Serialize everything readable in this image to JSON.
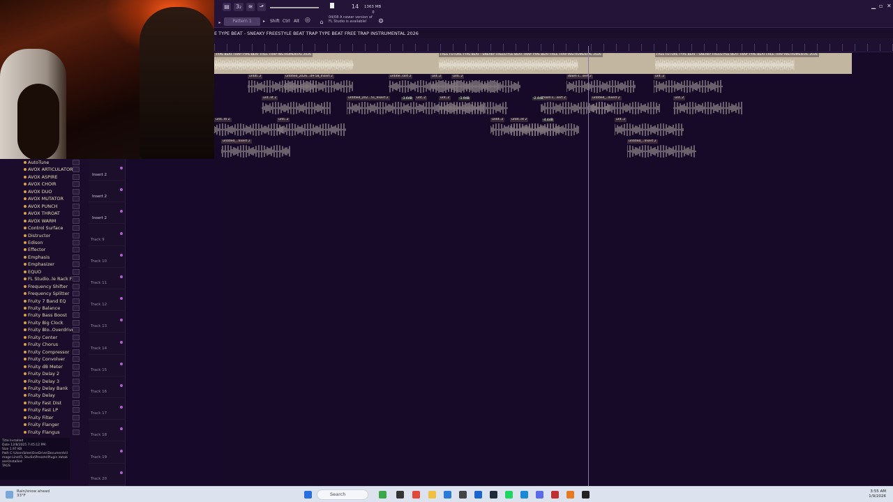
{
  "app": {
    "title": "FL Studio"
  },
  "toolbar": {
    "pattern_label": "Pattern 1",
    "modifier_keys": [
      "Shift",
      "Ctrl",
      "Alt"
    ],
    "tempo": "14",
    "memory": "1363 MB",
    "cpu": "0",
    "news_date": "04/08",
    "news_text": "A newer version of FL Studio is available!"
  },
  "playlist": {
    "title": "E TYPE BEAT - SNEAKY  FREESTYLE BEAT  TRAP TYPE BEAT  FREE TRAP INSTRUMENTAL 2026",
    "master_clip_label": "TYPE BEAT  TRAP TYPE BEAT  FREE TRAP INSTRUMENTAL 2026",
    "master_clip_label_2": "FREE FUTURE TYPE BEAT - SNEAKY  FREESTYLE BEAT  TRAP TYPE BEAT  FREE TRAP INSTRUMENTAL 2026",
    "master_clip_label_3": "FREE FUTURE TYPE BEAT - SNEAKY  FREESTYLE BEAT  TRAP TYPE BEAT  FREE TRAP INSTRUMENTAL 2026",
    "clip_labels": [
      "untitl..2",
      "untitled_2026...09-58_Insert 2",
      "untitle..sert 2",
      "unt..2",
      "unti..2",
      "doom s...sert 2",
      "unt..2",
      "unt..nt 2",
      "untitled_202...51_Insert 2",
      "unt..2",
      "unt..2",
      "doom s...sert 2",
      "untitled_..Insert 2",
      "unt..2",
      "unti..nt 2",
      "unti..2",
      "untit..2",
      "untit..nt 2",
      "unt..2",
      "untitled_..Insert 2",
      "untitled_..Insert 2"
    ],
    "gain_labels": [
      "-3.6dB",
      "-1.9dB",
      "-2.4dB",
      "-4.4dB"
    ]
  },
  "plugins": [
    "AutoTune",
    "AVOX ARTICULATOR",
    "AVOX ASPIRE",
    "AVOX CHOIR",
    "AVOX DUO",
    "AVOX MUTATOR",
    "AVOX PUNCH",
    "AVOX THROAT",
    "AVOX WARM",
    "Control Surface",
    "Distructor",
    "Edison",
    "Effector",
    "Emphasis",
    "Emphasizer",
    "EQUO",
    "FL Studio..le Rack FX",
    "Frequency Shifter",
    "Frequency Splitter",
    "Fruity 7 Band EQ",
    "Fruity Balance",
    "Fruity Bass Boost",
    "Fruity Big Clock",
    "Fruity Blo..Overdrive",
    "Fruity Center",
    "Fruity Chorus",
    "Fruity Compressor",
    "Fruity Convolver",
    "Fruity dB Meter",
    "Fruity Delay 2",
    "Fruity Delay 3",
    "Fruity Delay Bank",
    "Fruity Delay",
    "Fruity Fast Dist",
    "Fruity Fast LP",
    "Fruity Filter",
    "Fruity Flanger",
    "Fruity Flangus"
  ],
  "info": {
    "title_label": "Title",
    "title": "Installed",
    "date_label": "Date",
    "date": "12/8/2025 7:45:12 PM",
    "size_label": "Size",
    "size": "1.97 KB",
    "path_label": "Path",
    "path": "C:\\Users\\blee\\OneDrive\\Documents\\Image-Line\\FL Studio\\Presets\\Plugin database\\Installed",
    "tags_label": "TAGS"
  },
  "tracks": [
    {
      "name": "",
      "insert": "Insert 2"
    },
    {
      "name": "",
      "insert": "Insert 2"
    },
    {
      "name": "",
      "insert": "Insert 2"
    },
    {
      "name": "Track 9",
      "insert": ""
    },
    {
      "name": "Track 10",
      "insert": ""
    },
    {
      "name": "Track 11",
      "insert": ""
    },
    {
      "name": "Track 12",
      "insert": ""
    },
    {
      "name": "Track 13",
      "insert": ""
    },
    {
      "name": "Track 14",
      "insert": ""
    },
    {
      "name": "Track 15",
      "insert": ""
    },
    {
      "name": "Track 16",
      "insert": ""
    },
    {
      "name": "Track 17",
      "insert": ""
    },
    {
      "name": "Track 18",
      "insert": ""
    },
    {
      "name": "Track 19",
      "insert": ""
    },
    {
      "name": "Track 20",
      "insert": ""
    }
  ],
  "taskbar": {
    "search_placeholder": "Search",
    "weather_line1": "Rain/snow ahead",
    "weather_line2": "33°F",
    "time": "3:55 AM",
    "date": "1/9/2026"
  },
  "colors": {
    "accent": "#b060d0",
    "background": "#170a28",
    "clip": "#c2b6a0",
    "taskbar": "#dde3ee"
  }
}
